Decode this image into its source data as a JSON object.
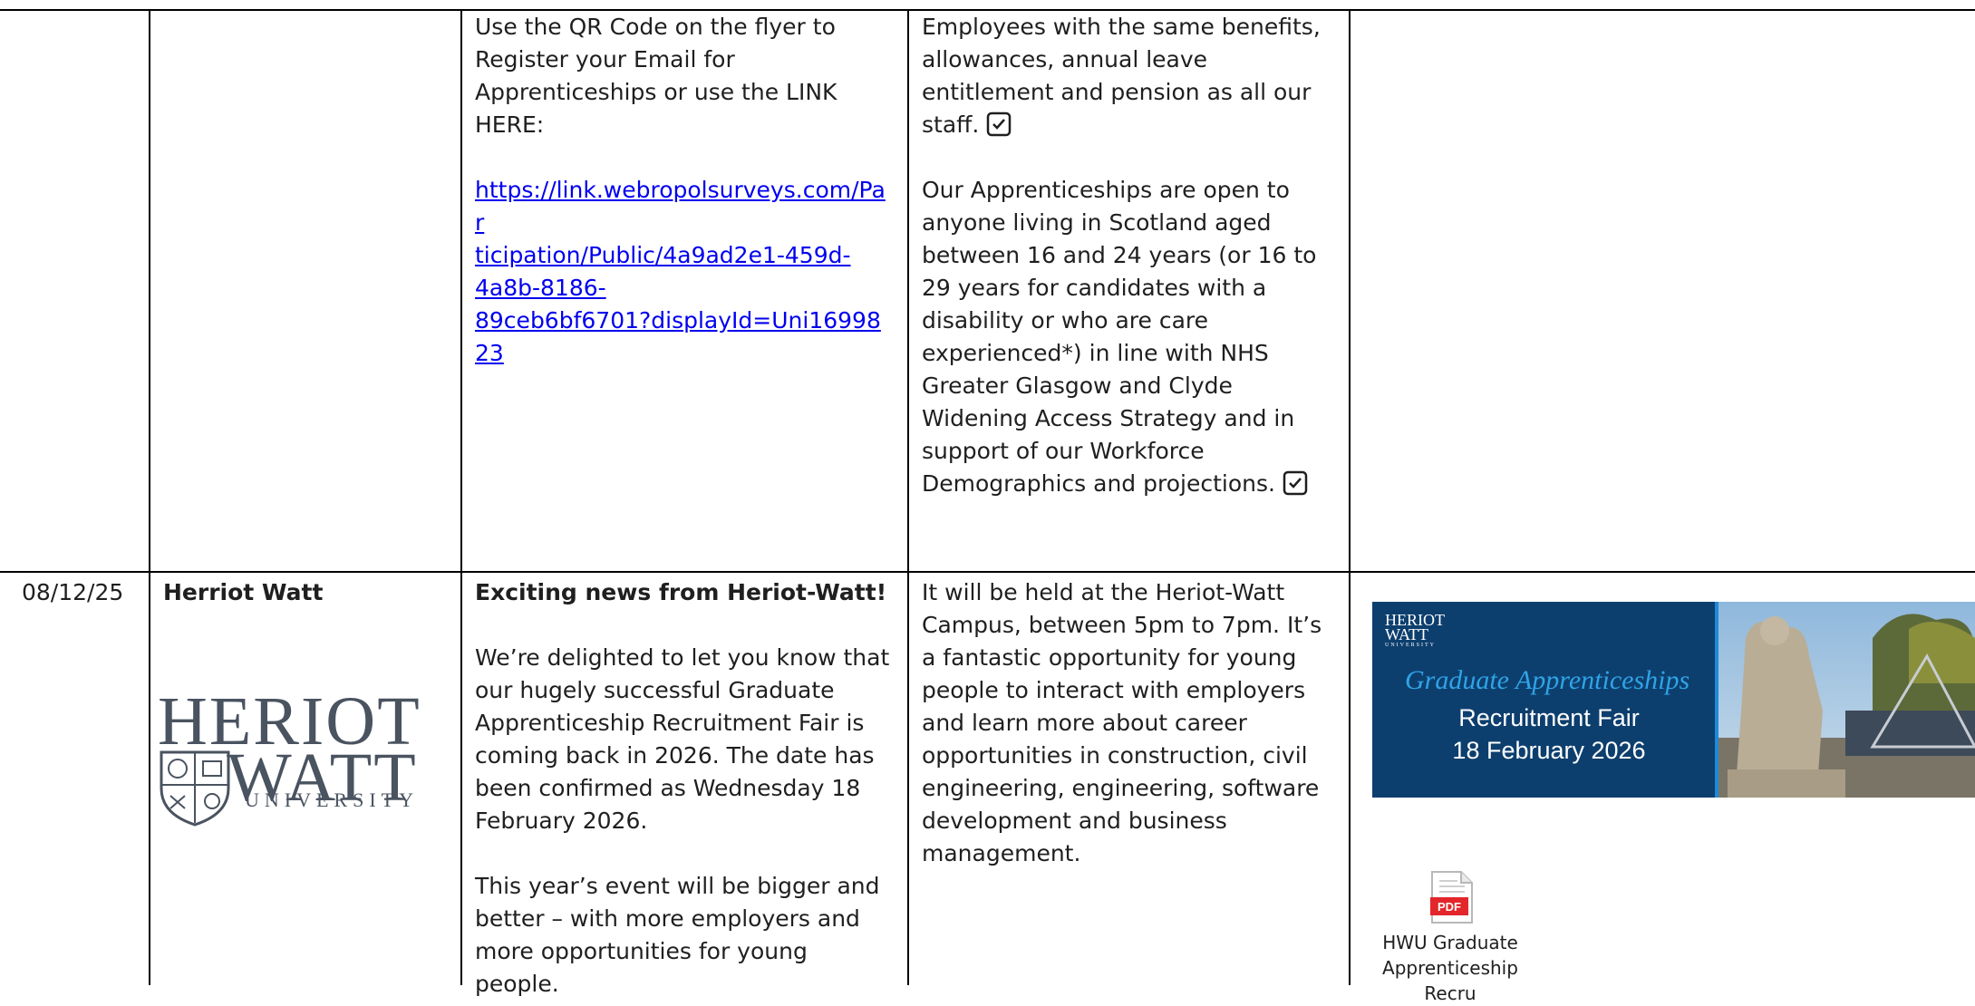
{
  "row1": {
    "col3": {
      "intro": "Use the QR Code on the flyer to Register your Email for Apprenticeships or use the LINK HERE:",
      "link_lines": [
        "https://link.webropolsurveys.com/Par",
        "ticipation/Public/4a9ad2e1-459d-",
        "4a8b-8186-",
        "89ceb6bf6701?displayId=Uni1699823"
      ]
    },
    "col4": {
      "para1": "Employees with the same benefits, allowances, annual leave entitlement and pension as all our staff.",
      "para2": "Our Apprenticeships are open to anyone living in Scotland aged between 16 and 24 years (or 16 to 29 years for candidates with a disability or who are care experienced*) in line with NHS Greater Glasgow and Clyde Widening Access Strategy and in support of our Workforce Demographics and projections."
    }
  },
  "row2": {
    "date": "08/12/25",
    "org": "Herriot Watt",
    "logo": {
      "line1": "HERIOT",
      "line2": "WATT",
      "line3": "UNIVERSITY"
    },
    "col3": {
      "heading": "Exciting news from Heriot-Watt!",
      "para1": "We’re delighted to let you know that our hugely successful Graduate Apprenticeship Recruitment Fair is coming back in 2026. The date has been confirmed as Wednesday 18 February 2026.",
      "para2": "This year’s event will be bigger and better – with more employers and more opportunities for young people."
    },
    "col4": {
      "para1": "It will be held at the Heriot-Watt Campus, between 5pm to 7pm. It’s a fantastic opportunity for young people to interact with employers and learn more about career opportunities in construction, civil engineering, engineering, software development and business management."
    },
    "banner": {
      "logo_line1": "HERIOT",
      "logo_line2": "WATT",
      "logo_line3": "UNIVERSITY",
      "title": "Graduate Apprenticeships",
      "subtitle_line1": "Recruitment Fair",
      "subtitle_line2": "18 February 2026"
    },
    "attachment": {
      "icon_label": "PDF",
      "caption_line1": "HWU Graduate",
      "caption_line2": "Apprenticeship Recru"
    }
  },
  "colors": {
    "link": "#0000ee",
    "banner_bg": "#0d3f6e",
    "banner_title": "#2fa4e7",
    "pdf_red": "#e3262b"
  }
}
